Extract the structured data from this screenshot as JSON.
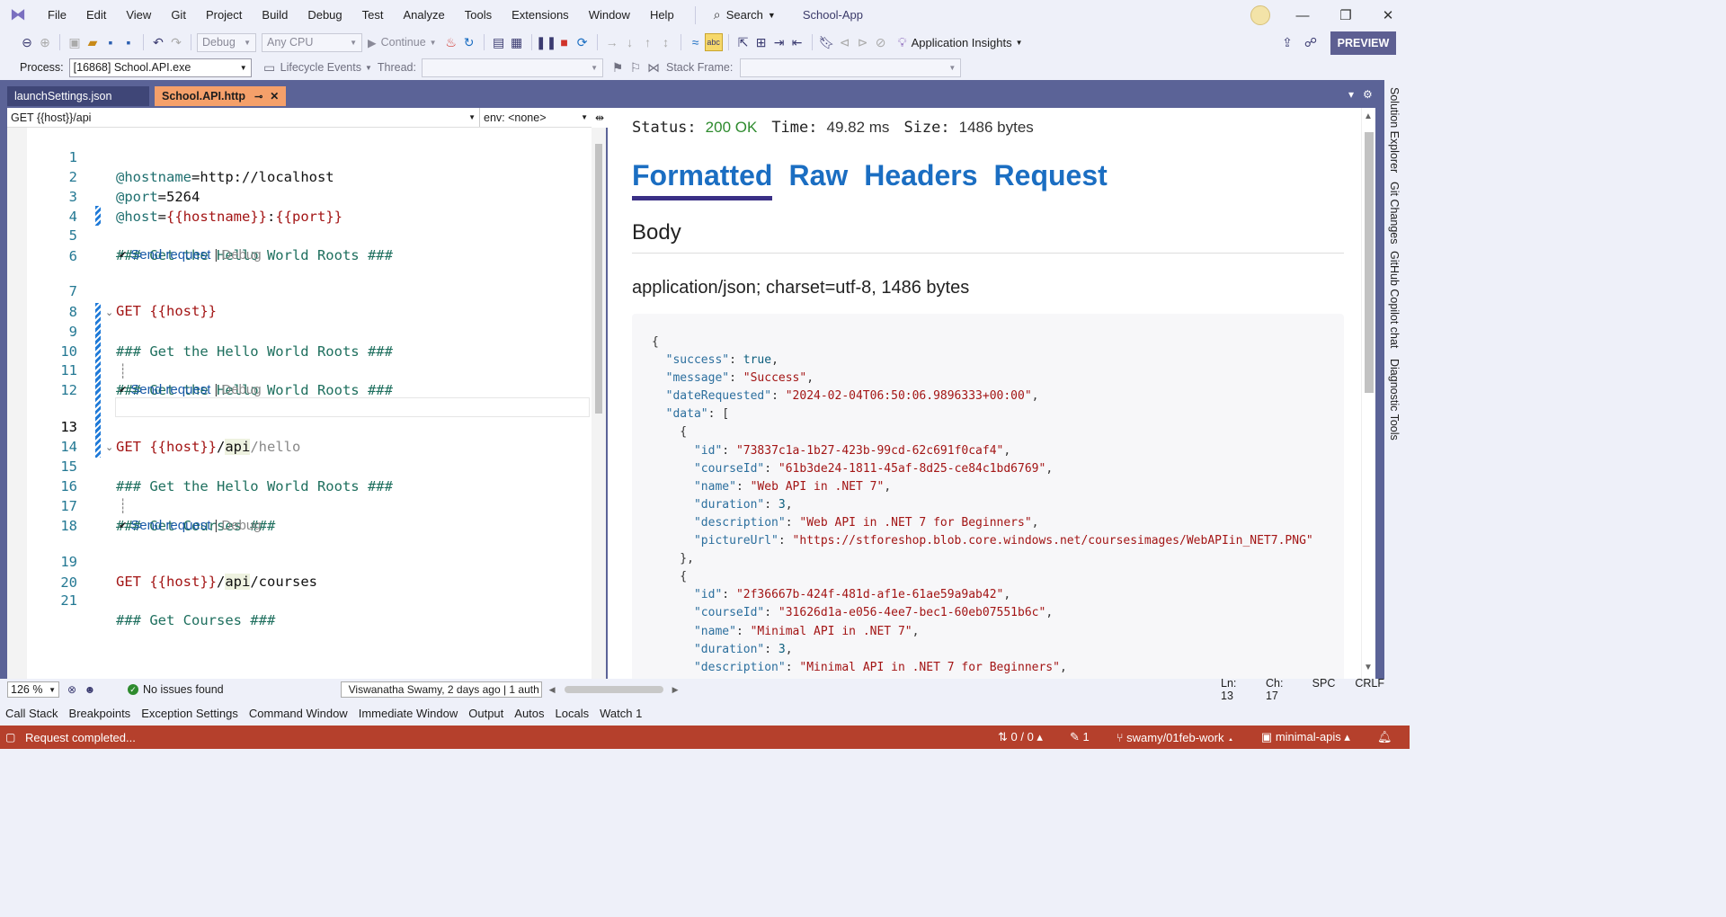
{
  "menubar": {
    "items": [
      "File",
      "Edit",
      "View",
      "Git",
      "Project",
      "Build",
      "Debug",
      "Test",
      "Analyze",
      "Tools",
      "Extensions",
      "Window",
      "Help"
    ],
    "search_label": "Search",
    "solution_name": "School-App"
  },
  "toolbar": {
    "config_combo": "Debug",
    "platform_combo": "Any CPU",
    "continue_label": "Continue",
    "app_insights_label": "Application Insights",
    "preview_label": "PREVIEW"
  },
  "debug_bar": {
    "process_label": "Process:",
    "process_value": "[16868] School.API.exe",
    "lifecycle_label": "Lifecycle Events",
    "thread_label": "Thread:",
    "stack_frame_label": "Stack Frame:"
  },
  "tabs": [
    {
      "label": "launchSettings.json"
    },
    {
      "label": "School.API.http"
    }
  ],
  "editor": {
    "nav_left": "GET {{host}}/api",
    "nav_right": "env: <none>",
    "codelens": {
      "send": "Send request",
      "sep": "|",
      "debug": "Debug"
    },
    "lines": [
      {
        "n": "1",
        "t": "@hostname=http://localhost"
      },
      {
        "n": "2",
        "t": "@port=5264"
      },
      {
        "n": "3",
        "t": "@host={{hostname}}:{{port}}"
      },
      {
        "n": "4",
        "t": ""
      },
      {
        "n": "5",
        "t": "### Get the Hello World Roots ###"
      },
      {
        "n": "6",
        "t": ""
      },
      {
        "n": "7",
        "t": "GET {{host}}"
      },
      {
        "n": "8",
        "t": ""
      },
      {
        "n": "9",
        "t": "### Get the Hello World Roots ###"
      },
      {
        "n": "10",
        "t": ""
      },
      {
        "n": "11",
        "t": "### Get the Hello World Roots ###"
      },
      {
        "n": "12",
        "t": ""
      },
      {
        "n": "13",
        "t": "GET {{host}}/api/hello"
      },
      {
        "n": "14",
        "t": ""
      },
      {
        "n": "15",
        "t": "### Get the Hello World Roots ###"
      },
      {
        "n": "16",
        "t": ""
      },
      {
        "n": "17",
        "t": "### Get Courses ###"
      },
      {
        "n": "18",
        "t": ""
      },
      {
        "n": "19",
        "t": "GET {{host}}/api/courses"
      },
      {
        "n": "20",
        "t": ""
      },
      {
        "n": "21",
        "t": "### Get Courses ###"
      }
    ]
  },
  "response": {
    "status_label": "Status:",
    "status_value": "200 OK",
    "time_label": "Time:",
    "time_value": "49.82 ms",
    "size_label": "Size:",
    "size_value": "1486 bytes",
    "tabs": [
      "Formatted",
      "Raw",
      "Headers",
      "Request"
    ],
    "body_heading": "Body",
    "content_type": "application/json; charset=utf-8, 1486 bytes",
    "json_lines": [
      "{",
      "  \"success\": true,",
      "  \"message\": \"Success\",",
      "  \"dateRequested\": \"2024-02-04T06:50:06.9896333+00:00\",",
      "  \"data\": [",
      "    {",
      "      \"id\": \"73837c1a-1b27-423b-99cd-62c691f0caf4\",",
      "      \"courseId\": \"61b3de24-1811-45af-8d25-ce84c1bd6769\",",
      "      \"name\": \"Web API in .NET 7\",",
      "      \"duration\": 3,",
      "      \"description\": \"Web API in .NET 7 for Beginners\",",
      "      \"pictureUrl\": \"https://stforeshop.blob.core.windows.net/coursesimages/WebAPIin_NET7.PNG\"",
      "    },",
      "    {",
      "      \"id\": \"2f36667b-424f-481d-af1e-61ae59a9ab42\",",
      "      \"courseId\": \"31626d1a-e056-4ee7-bec1-60eb07551b6c\",",
      "      \"name\": \"Minimal API in .NET 7\",",
      "      \"duration\": 3,",
      "      \"description\": \"Minimal API in .NET 7 for Beginners\","
    ]
  },
  "side_tabs": [
    "Solution Explorer",
    "Git Changes",
    "GitHub Copilot chat",
    "Diagnostic Tools"
  ],
  "editor_status": {
    "zoom": "126 %",
    "issues": "No issues found",
    "blame": "Viswanatha Swamy, 2 days ago | 1 auth",
    "ln": "Ln: 13",
    "ch": "Ch: 17",
    "spc": "SPC",
    "crlf": "CRLF"
  },
  "tool_tabs": [
    "Call Stack",
    "Breakpoints",
    "Exception Settings",
    "Command Window",
    "Immediate Window",
    "Output",
    "Autos",
    "Locals",
    "Watch 1"
  ],
  "statusbar": {
    "message": "Request completed...",
    "sync": "0 / 0",
    "edits": "1",
    "branch": "swamy/01feb-work",
    "repo": "minimal-apis"
  },
  "colors": {
    "statusbar": "#b5402c",
    "accent": "#5d5f92",
    "active_tab": "#f5a06a"
  }
}
